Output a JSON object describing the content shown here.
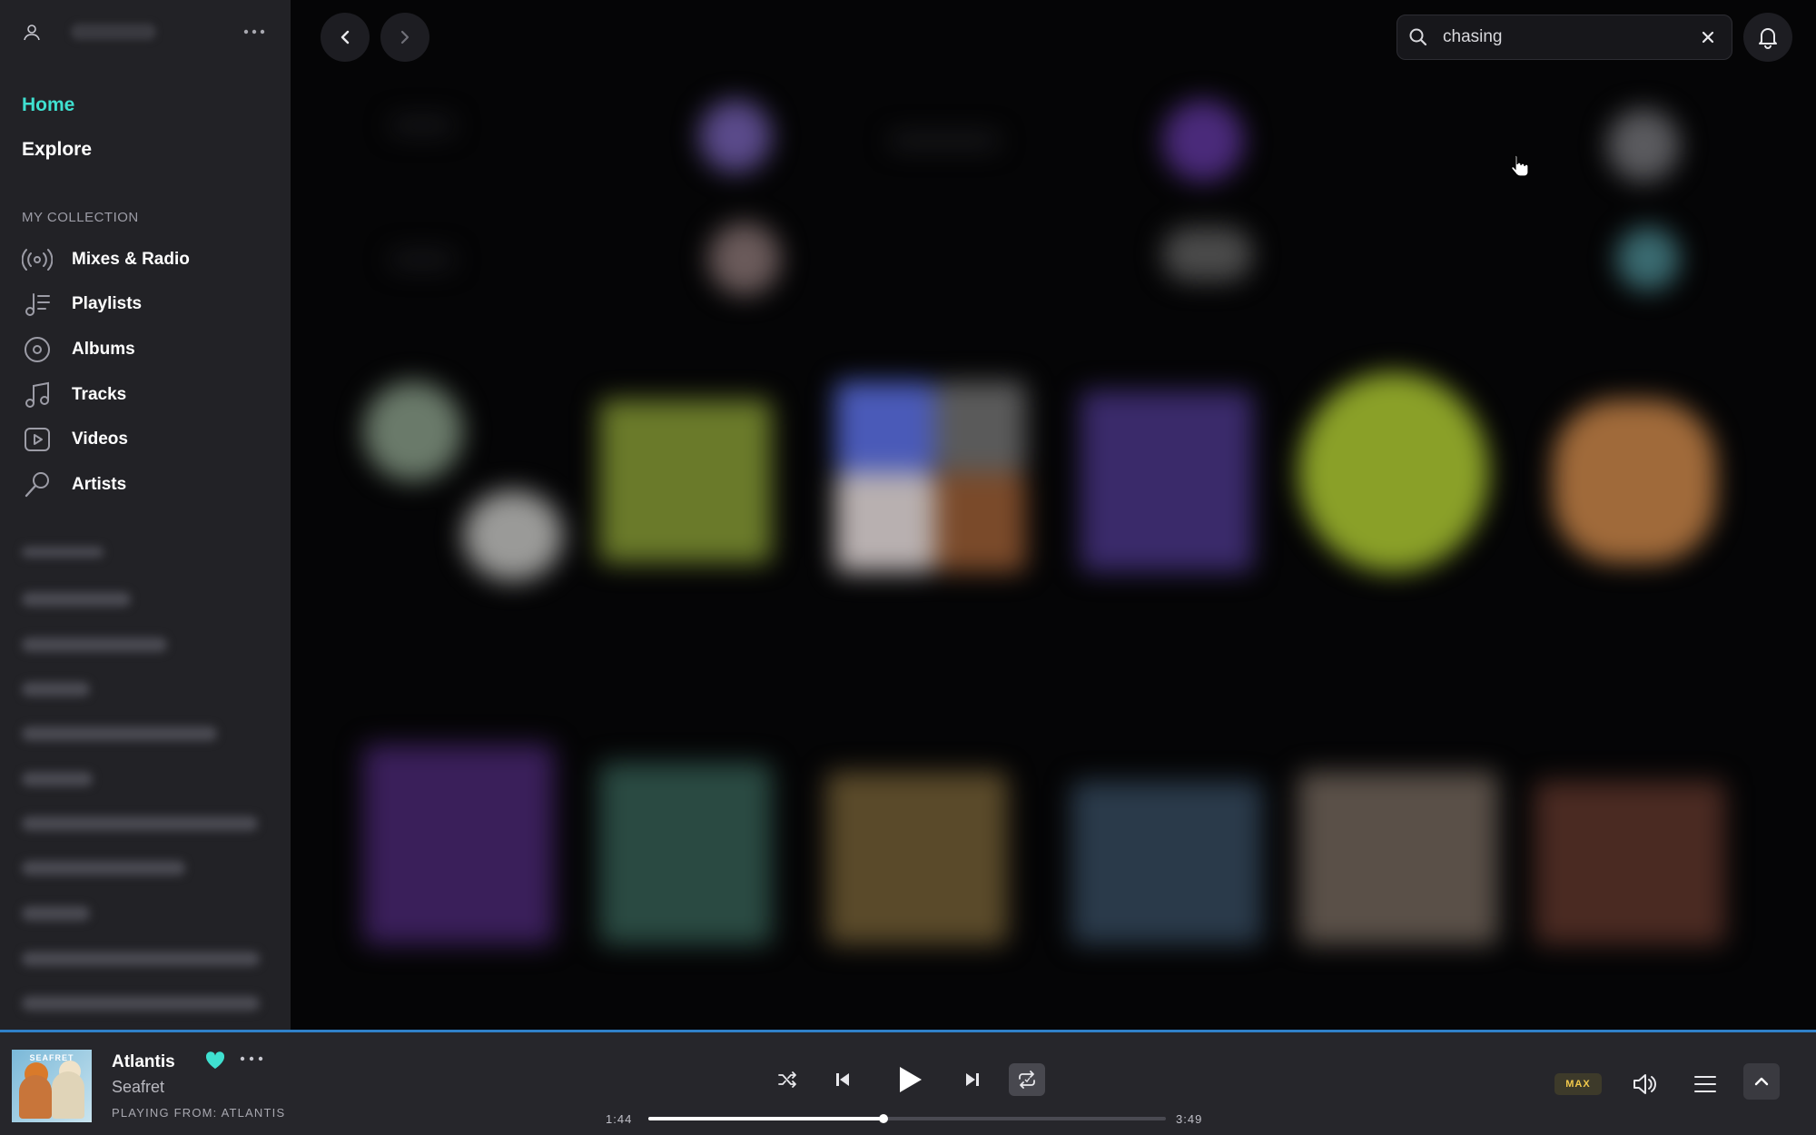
{
  "sidebar": {
    "nav": [
      {
        "label": "Home",
        "active": true
      },
      {
        "label": "Explore",
        "active": false
      }
    ],
    "collection_heading": "MY COLLECTION",
    "collection": [
      {
        "label": "Mixes & Radio",
        "icon": "radio-icon"
      },
      {
        "label": "Playlists",
        "icon": "playlist-icon"
      },
      {
        "label": "Albums",
        "icon": "album-icon"
      },
      {
        "label": "Tracks",
        "icon": "music-note-icon"
      },
      {
        "label": "Videos",
        "icon": "video-icon"
      },
      {
        "label": "Artists",
        "icon": "microphone-icon"
      }
    ]
  },
  "search": {
    "value": "chasing",
    "placeholder": "Search"
  },
  "player": {
    "album_art_text": "SEAFRET",
    "title": "Atlantis",
    "artist": "Seafret",
    "playing_from": "PLAYING FROM: ATLANTIS",
    "liked": true,
    "elapsed": "1:44",
    "duration": "3:49",
    "progress": 0.4541,
    "quality_badge": "MAX"
  },
  "colors": {
    "accent": "#3fe0d0",
    "progress_bar": "#2f80c8",
    "badge_text": "#f2c94c"
  }
}
